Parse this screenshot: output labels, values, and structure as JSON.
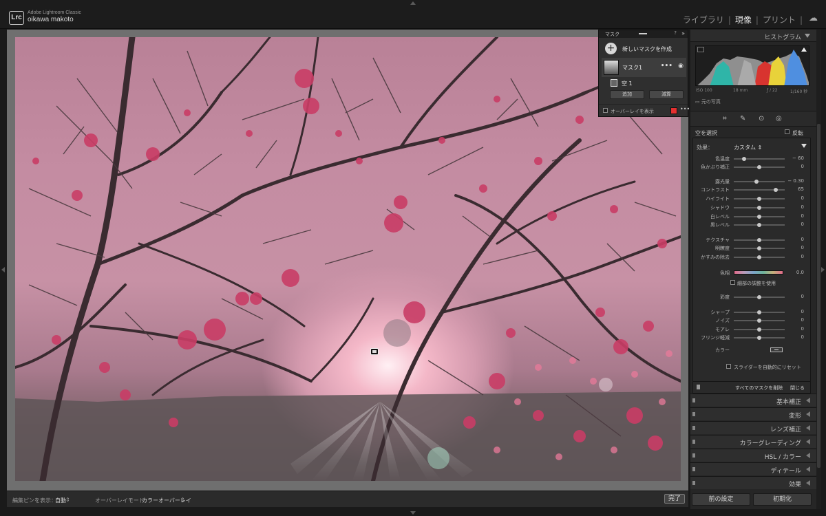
{
  "app": {
    "name": "Adobe Lightroom Classic",
    "logo": "Lrc",
    "user": "oikawa makoto"
  },
  "modules": {
    "library": "ライブラリ",
    "develop": "現像",
    "print": "プリント",
    "active": "develop"
  },
  "toolbar": {
    "pins_label": "編集ピンを表示：",
    "pins_value": "自動",
    "overlay_mode_label": "オーバーレイモード：",
    "overlay_mode_value": "カラーオーバーレイ",
    "done": "完了"
  },
  "mask_panel": {
    "title": "マスク",
    "create_new": "新しいマスクを作成",
    "mask_name": "マスク1",
    "sub_mask_name": "空 1",
    "add": "追加",
    "subtract": "減算",
    "show_overlay": "オーバーレイを表示",
    "overlay_color": "#e53030"
  },
  "histogram": {
    "title": "ヒストグラム",
    "iso": "ISO 100",
    "focal": "18 mm",
    "aperture": "ƒ / 22",
    "shutter": "1/160 秒",
    "original_photo": "元の写真"
  },
  "adjust": {
    "sky_select": "空を選択",
    "invert": "反転",
    "effect_label": "効果：",
    "effect_value": "カスタム",
    "sliders": [
      {
        "label": "色温度",
        "value": "− 60",
        "pos": 0.2
      },
      {
        "label": "色かぶり補正",
        "value": "0",
        "pos": 0.5
      },
      {
        "label": "露光量",
        "value": "− 0.30",
        "pos": 0.45
      },
      {
        "label": "コントラスト",
        "value": "65",
        "pos": 0.82
      },
      {
        "label": "ハイライト",
        "value": "0",
        "pos": 0.5
      },
      {
        "label": "シャドウ",
        "value": "0",
        "pos": 0.5
      },
      {
        "label": "白レベル",
        "value": "0",
        "pos": 0.5
      },
      {
        "label": "黒レベル",
        "value": "0",
        "pos": 0.5
      },
      {
        "label": "テクスチャ",
        "value": "0",
        "pos": 0.5
      },
      {
        "label": "明瞭度",
        "value": "0",
        "pos": 0.5
      },
      {
        "label": "かすみの除去",
        "value": "0",
        "pos": 0.5
      },
      {
        "label": "彩度",
        "value": "0",
        "pos": 0.5
      },
      {
        "label": "シャープ",
        "value": "0",
        "pos": 0.5
      },
      {
        "label": "ノイズ",
        "value": "0",
        "pos": 0.5
      },
      {
        "label": "モアレ",
        "value": "0",
        "pos": 0.5
      },
      {
        "label": "フリンジ軽減",
        "value": "0",
        "pos": 0.5
      }
    ],
    "hue_label": "色相",
    "hue_value": "0.0",
    "fine_adjust": "細部の調整を使用",
    "color_label": "カラー",
    "auto_reset": "スライダーを自動的にリセット",
    "delete_all": "すべてのマスクを削除",
    "close": "閉じる"
  },
  "sections": [
    "基本補正",
    "変形",
    "レンズ補正",
    "カラーグレーディング",
    "HSL / カラー",
    "ディテール",
    "効果"
  ],
  "bottom_buttons": {
    "previous": "前の設定",
    "reset": "初期化"
  }
}
